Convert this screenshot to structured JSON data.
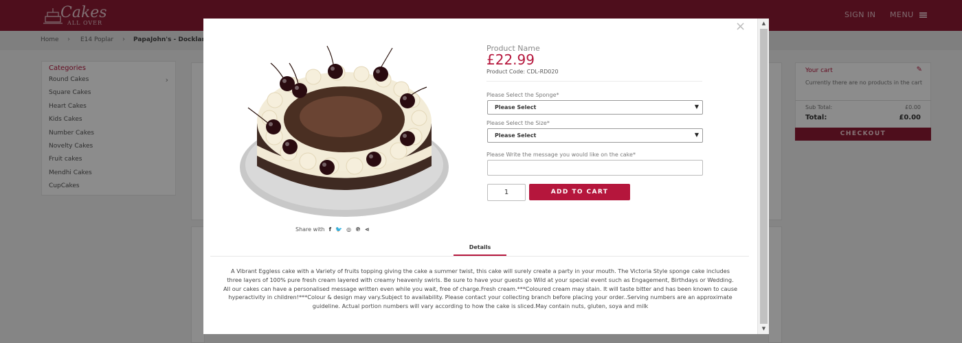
{
  "header": {
    "logo_line1": "Cakes",
    "logo_line2": "ALL OVER",
    "signin": "SIGN IN",
    "menu": "MENU"
  },
  "breadcrumb": [
    "Home",
    "E14 Poplar",
    "PapaJohn's - Docklan"
  ],
  "categories": {
    "title": "Categories",
    "items": [
      "Round Cakes",
      "Square Cakes",
      "Heart Cakes",
      "Kids Cakes",
      "Number Cakes",
      "Novelty Cakes",
      "Fruit cakes",
      "Mendhi Cakes",
      "CupCakes"
    ]
  },
  "cart": {
    "title": "Your cart",
    "empty_text": "Currently there are no products in the cart",
    "subtotal_label": "Sub Total:",
    "subtotal_value": "£0.00",
    "total_label": "Total:",
    "total_value": "£0.00",
    "checkout_label": "CHECKOUT"
  },
  "modal": {
    "close": "×",
    "product_name": "Product Name",
    "price": "£22.99",
    "product_code": "Product Code: CDL-RD020",
    "sponge_label": "Please Select the Sponge*",
    "sponge_value": "Please Select",
    "size_label": "Please Select the Size*",
    "size_value": "Please Select",
    "message_label": "Please Write the message you would like on the cake*",
    "message_value": "",
    "quantity": "1",
    "add_to_cart": "ADD TO CART",
    "share_label": "Share with",
    "share_icons": [
      "f",
      "🐦",
      "◎",
      "℗",
      "⋖"
    ],
    "tab_details": "Details",
    "description": "A Vibrant Eggless cake with a Variety of fruits topping giving the cake a summer twist, this cake will surely create a party in your mouth. The Victoria Style sponge cake includes three layers of 100% pure fresh cream layered with creamy heavenly swirls. Be sure to have your guests go Wild at your special event such as Engagement, Birthdays or Wedding. All our cakes can have a personalised message written even while you wait, free of charge.Fresh cream.***Coloured cream may stain. It will taste bitter and has been known to cause hyperactivity in children!***Colour & design may vary.Subject to availability. Please contact your collecting branch before placing your order..Serving numbers are an approximate guideline. Actual portion numbers will vary according to how the cake is sliced.May contain nuts, gluten, soya and milk"
  },
  "colors": {
    "brand": "#8e1b34",
    "accent": "#b5163c"
  }
}
